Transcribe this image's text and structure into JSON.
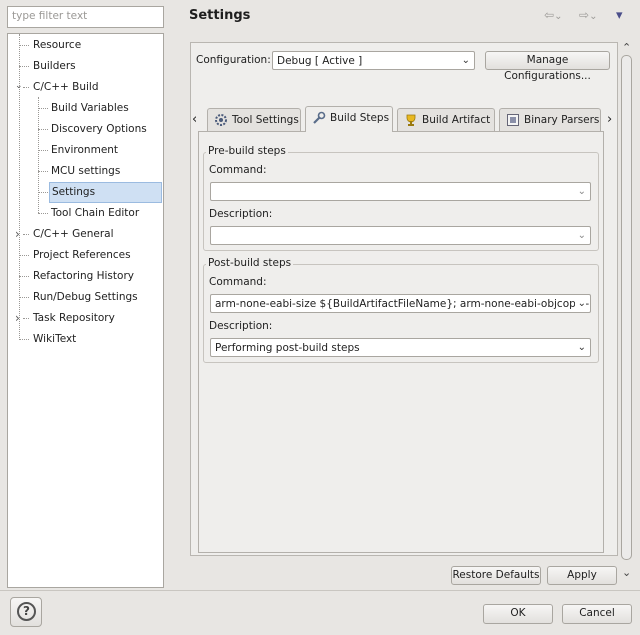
{
  "filter": {
    "placeholder": "type filter text"
  },
  "tree": {
    "items": [
      {
        "label": "Resource"
      },
      {
        "label": "Builders"
      },
      {
        "label": "C/C++ Build",
        "expander": "⌄"
      },
      {
        "label": "Build Variables"
      },
      {
        "label": "Discovery Options"
      },
      {
        "label": "Environment"
      },
      {
        "label": "MCU settings"
      },
      {
        "label": "Settings"
      },
      {
        "label": "Tool Chain Editor"
      },
      {
        "label": "C/C++ General",
        "expander": "›"
      },
      {
        "label": "Project References"
      },
      {
        "label": "Refactoring History"
      },
      {
        "label": "Run/Debug Settings"
      },
      {
        "label": "Task Repository",
        "expander": "›"
      },
      {
        "label": "WikiText"
      }
    ]
  },
  "header": {
    "title": "Settings",
    "back_icon": "⇦",
    "forward_icon": "⇨",
    "menu_icon": "▾",
    "dropdown_icon": "⌄"
  },
  "config": {
    "label": "Configuration:",
    "value": "Debug  [ Active ]",
    "manage_button": "Manage Configurations..."
  },
  "tabs": {
    "left_scroll": "‹",
    "right_scroll": "›",
    "items": [
      {
        "label": "Tool Settings",
        "icon": "gear-icon"
      },
      {
        "label": "Build Steps",
        "icon": "wrench-icon"
      },
      {
        "label": "Build Artifact",
        "icon": "trophy-icon"
      },
      {
        "label": "Binary Parsers",
        "icon": "binary-icon"
      }
    ]
  },
  "prebuild": {
    "title": "Pre-build steps",
    "command_label": "Command:",
    "command_value": "",
    "description_label": "Description:",
    "description_value": ""
  },
  "postbuild": {
    "title": "Post-build steps",
    "command_label": "Command:",
    "command_value": "arm-none-eabi-size ${BuildArtifactFileName}; arm-none-eabi-objcopy -O",
    "description_label": "Description:",
    "description_value": "Performing post-build steps"
  },
  "buttons": {
    "restore": "Restore Defaults",
    "apply": "Apply",
    "ok": "OK",
    "cancel": "Cancel",
    "help": "?"
  },
  "scroll": {
    "up": "⌃",
    "down": "⌄"
  },
  "colors": {
    "selection": "#cfe0f3",
    "accent": "#4a4e8a"
  }
}
